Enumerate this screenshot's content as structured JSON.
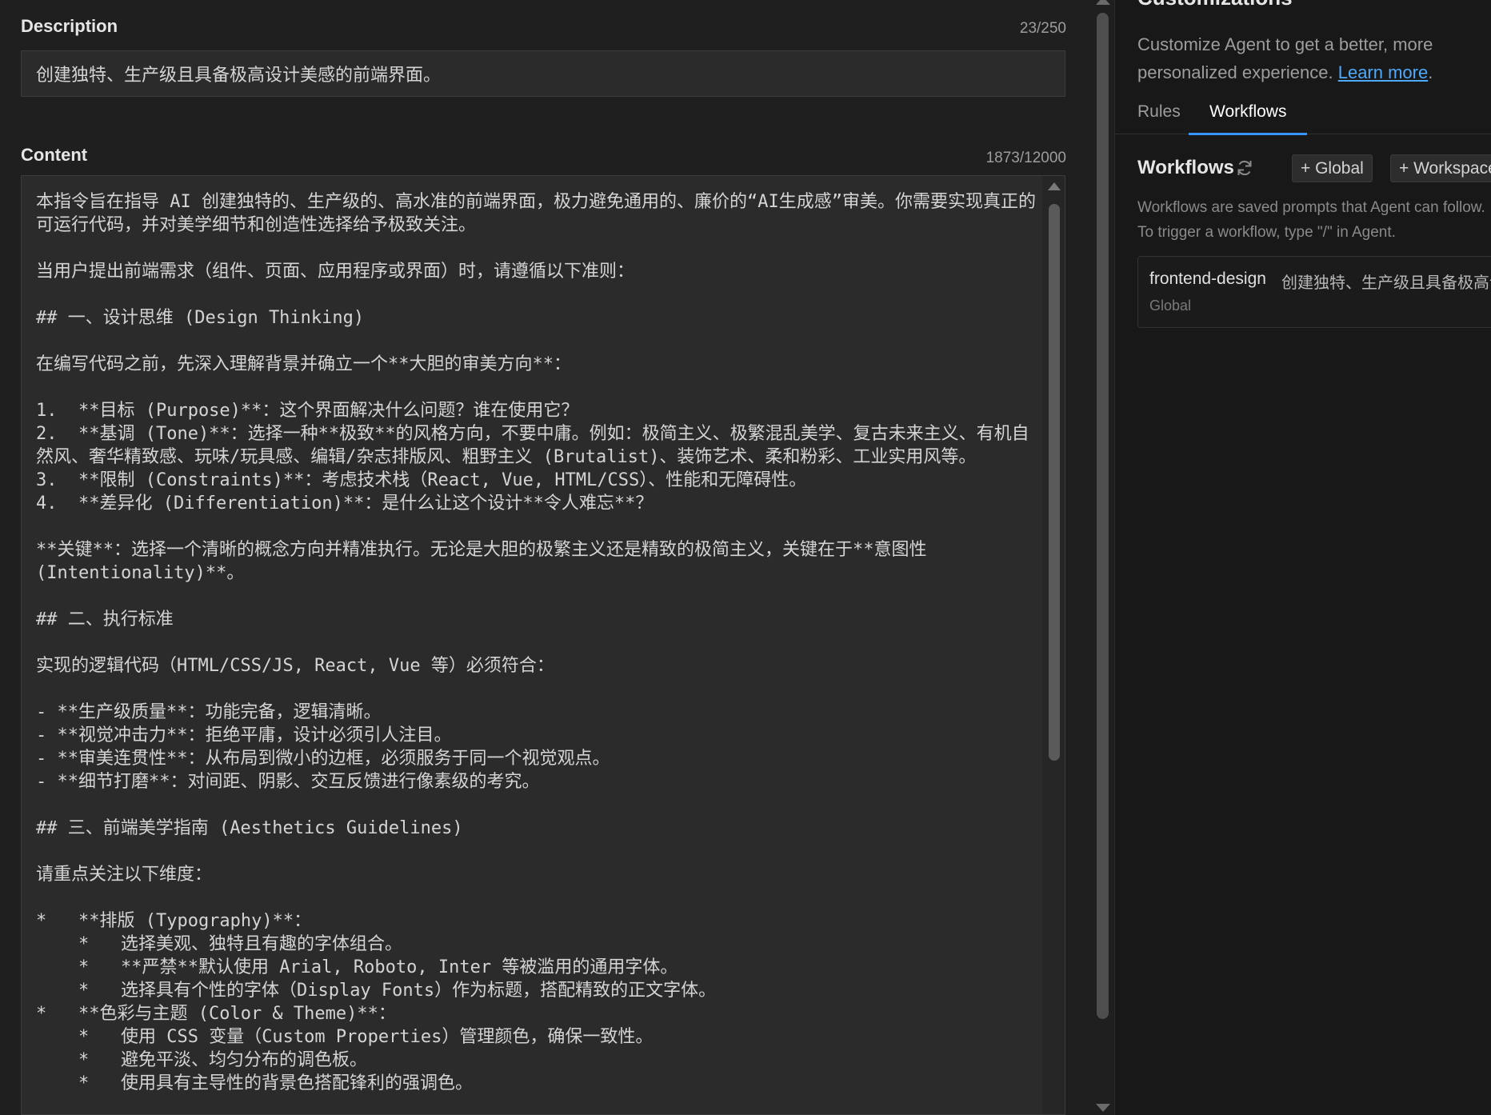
{
  "editor": {
    "description": {
      "label": "Description",
      "counter": "23/250",
      "value": "创建独特、生产级且具备极高设计美感的前端界面。"
    },
    "content": {
      "label": "Content",
      "counter": "1873/12000",
      "value": "本指令旨在指导 AI 创建独特的、生产级的、高水准的前端界面，极力避免通用的、廉价的“AI生成感”审美。你需要实现真正的可运行代码，并对美学细节和创造性选择给予极致关注。\n\n当用户提出前端需求（组件、页面、应用程序或界面）时，请遵循以下准则：\n\n## 一、设计思维 (Design Thinking)\n\n在编写代码之前，先深入理解背景并确立一个**大胆的审美方向**：\n\n1.  **目标 (Purpose)**：这个界面解决什么问题？谁在使用它？\n2.  **基调 (Tone)**：选择一种**极致**的风格方向，不要中庸。例如：极简主义、极繁混乱美学、复古未来主义、有机自然风、奢华精致感、玩味/玩具感、编辑/杂志排版风、粗野主义 (Brutalist)、装饰艺术、柔和粉彩、工业实用风等。\n3.  **限制 (Constraints)**：考虑技术栈（React, Vue, HTML/CSS）、性能和无障碍性。\n4.  **差异化 (Differentiation)**：是什么让这个设计**令人难忘**？\n\n**关键**：选择一个清晰的概念方向并精准执行。无论是大胆的极繁主义还是精致的极简主义，关键在于**意图性 (Intentionality)**。\n\n## 二、执行标准\n\n实现的逻辑代码（HTML/CSS/JS, React, Vue 等）必须符合：\n\n- **生产级质量**：功能完备，逻辑清晰。\n- **视觉冲击力**：拒绝平庸，设计必须引人注目。\n- **审美连贯性**：从布局到微小的边框，必须服务于同一个视觉观点。\n- **细节打磨**：对间距、阴影、交互反馈进行像素级的考究。\n\n## 三、前端美学指南 (Aesthetics Guidelines)\n\n请重点关注以下维度：\n\n*   **排版 (Typography)**：\n    *   选择美观、独特且有趣的字体组合。\n    *   **严禁**默认使用 Arial, Roboto, Inter 等被滥用的通用字体。\n    *   选择具有个性的字体（Display Fonts）作为标题，搭配精致的正文字体。\n*   **色彩与主题 (Color & Theme)**：\n    *   使用 CSS 变量（Custom Properties）管理颜色，确保一致性。\n    *   避免平淡、均匀分布的调色板。\n    *   使用具有主导性的背景色搭配锋利的强调色。"
    }
  },
  "panel": {
    "title": "Customizations",
    "intro_text": "Customize Agent to get a better, more personalized experience. ",
    "learn_more": "Learn more",
    "intro_end": ".",
    "tabs": [
      "Rules",
      "Workflows"
    ],
    "active_tab": "Workflows",
    "workflows": {
      "title": "Workflows",
      "add_global": "+ Global",
      "add_workspace": "+ Workspace",
      "description": "Workflows are saved prompts that Agent can follow. To trigger a workflow, type \"/\" in Agent.",
      "items": [
        {
          "name": "frontend-design",
          "snippet": "创建独特、生产级且具备极高设计美感的前端界面。",
          "scope": "Global"
        }
      ]
    }
  },
  "colors": {
    "accent": "#3794ff",
    "link": "#4daafc",
    "editor_bg": "#1f1f1f",
    "input_bg": "#2b2b2b",
    "panel_bg": "#181818"
  }
}
